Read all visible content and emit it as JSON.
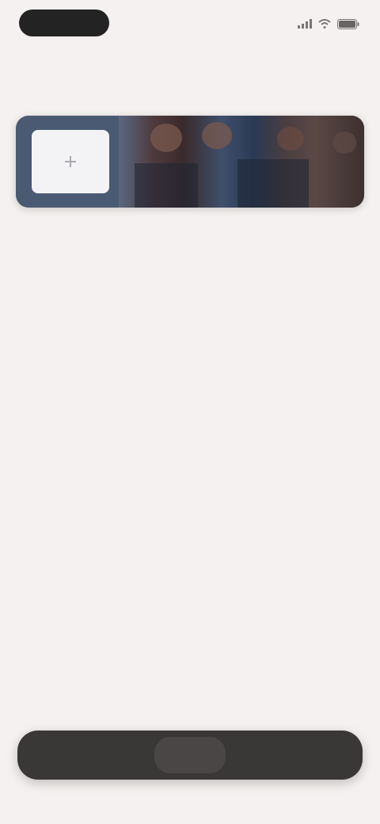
{
  "status_bar": {
    "time": "",
    "icons": [
      "signal-icon",
      "wifi-icon",
      "battery-icon"
    ]
  },
  "header": {
    "title": ""
  },
  "photo_strip": {
    "add_icon": "plus-icon"
  },
  "bottom_bar": {
    "left_label": "",
    "middle_label": "",
    "right_label": ""
  },
  "colors": {
    "background": "#f5f1f0",
    "bottom_bar": "#3a3737",
    "status_pill": "#232323"
  }
}
